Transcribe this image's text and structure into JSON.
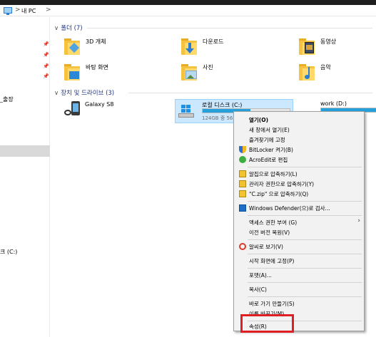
{
  "address": {
    "crumb": "내 PC",
    "separator": ">"
  },
  "nav": {
    "labels": [
      {
        "text": "_출장",
        "id": "nav-chuljang"
      },
      {
        "text": "크 (C:)",
        "id": "nav-c-drive"
      }
    ]
  },
  "folders_group": {
    "title": "폴더 (7)",
    "chevron": "∨"
  },
  "folders": [
    {
      "name": "3D 개체",
      "icon": "3d-objects-folder-icon"
    },
    {
      "name": "다운로드",
      "icon": "downloads-folder-icon"
    },
    {
      "name": "동영상",
      "icon": "videos-folder-icon"
    },
    {
      "name": "바탕 화면",
      "icon": "desktop-folder-icon"
    },
    {
      "name": "사진",
      "icon": "pictures-folder-icon"
    },
    {
      "name": "음악",
      "icon": "music-folder-icon"
    }
  ],
  "drives_group": {
    "title": "장치 및 드라이브 (3)",
    "chevron": "∨"
  },
  "drives": [
    {
      "name": "Galaxy S8",
      "icon": "phone-icon"
    },
    {
      "name": "로컬 디스크 (C:)",
      "sub": "124GB 중 56",
      "fill_percent": 55,
      "selected": true,
      "icon": "windows-drive-icon"
    },
    {
      "name": "work (D:)",
      "fill_percent": 100,
      "icon": "drive-icon"
    }
  ],
  "context_menu": {
    "items": [
      {
        "label": "열기(O)",
        "bold": true,
        "icon": ""
      },
      {
        "label": "새 창에서 열기(E)",
        "icon": ""
      },
      {
        "label": "즐겨찾기에 고정",
        "icon": ""
      },
      {
        "label": "BitLocker 켜기(B)",
        "icon": "shield-icon"
      },
      {
        "label": "AcroEdit로 편집",
        "icon": "acroedit-icon"
      },
      {
        "label": "알집으로 압축하기(L)",
        "icon": "alzip-icon"
      },
      {
        "label": "관리자 권한으로 압축하기(Y)",
        "icon": "alzip-admin-icon"
      },
      {
        "label": "\"C.zip\" 으로 압축하기(Q)",
        "icon": "alzip-zip-icon"
      },
      {
        "label": "Windows Defender(으)로 검사...",
        "icon": "defender-icon"
      },
      {
        "label": "액세스 권한 부여 (G)",
        "icon": "",
        "submenu": true
      },
      {
        "label": "이전 버전 복원(V)",
        "icon": ""
      },
      {
        "label": "알씨로 보기(V)",
        "icon": "alsee-icon"
      },
      {
        "label": "시작 화면에 고정(P)",
        "icon": ""
      },
      {
        "label": "포맷(A)...",
        "icon": ""
      },
      {
        "label": "복사(C)",
        "icon": ""
      },
      {
        "label": "바로 가기 만들기(S)",
        "icon": ""
      },
      {
        "label": "이름 바꾸기(M)",
        "icon": ""
      },
      {
        "label": "속성(R)",
        "icon": ""
      }
    ],
    "submenu_arrow": "›"
  },
  "highlight": {
    "color": "#e01f24",
    "target": "속성(R)"
  },
  "colors": {
    "accent": "#26a0da",
    "selection": "#cce8ff",
    "group_title": "#1e3287"
  }
}
